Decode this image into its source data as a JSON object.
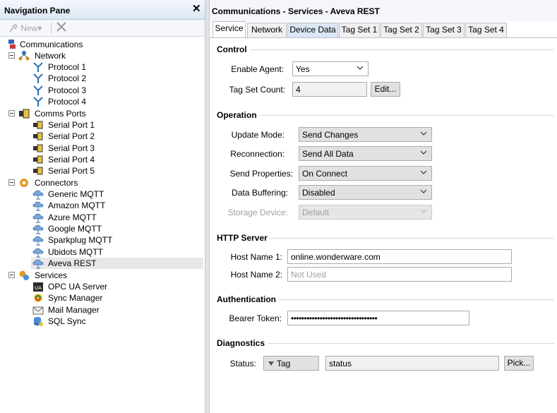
{
  "nav": {
    "title": "Navigation Pane",
    "toolbar": {
      "new_label": "New",
      "new_arrow": "▾"
    },
    "tree": {
      "root": {
        "label": "Communications",
        "icon": "communications-icon"
      },
      "network": {
        "label": "Network",
        "icon": "network-icon",
        "items": [
          "Protocol 1",
          "Protocol 2",
          "Protocol 3",
          "Protocol 4"
        ]
      },
      "comms_ports": {
        "label": "Comms Ports",
        "icon": "comms-ports-icon",
        "items": [
          "Serial Port 1",
          "Serial Port 2",
          "Serial Port 3",
          "Serial Port 4",
          "Serial Port 5"
        ]
      },
      "connectors": {
        "label": "Connectors",
        "icon": "connectors-icon",
        "items": [
          "Generic MQTT",
          "Amazon MQTT",
          "Azure MQTT",
          "Google MQTT",
          "Sparkplug MQTT",
          "Ubidots MQTT",
          "Aveva REST"
        ],
        "selected": "Aveva REST"
      },
      "services": {
        "label": "Services",
        "icon": "services-icon",
        "items": [
          "OPC UA Server",
          "Sync Manager",
          "Mail Manager",
          "SQL Sync"
        ]
      }
    }
  },
  "details": {
    "title": "Communications - Services - Aveva REST",
    "tabs": [
      "Service",
      "Network",
      "Device Data",
      "Tag Set 1",
      "Tag Set 2",
      "Tag Set 3",
      "Tag Set 4"
    ],
    "active_tab": "Service",
    "control": {
      "heading": "Control",
      "enable_agent_label": "Enable Agent:",
      "enable_agent_value": "Yes",
      "tag_set_count_label": "Tag Set Count:",
      "tag_set_count_value": "4",
      "edit_label": "Edit..."
    },
    "operation": {
      "heading": "Operation",
      "update_mode_label": "Update Mode:",
      "update_mode_value": "Send Changes",
      "reconnection_label": "Reconnection:",
      "reconnection_value": "Send All Data",
      "send_properties_label": "Send Properties:",
      "send_properties_value": "On Connect",
      "data_buffering_label": "Data Buffering:",
      "data_buffering_value": "Disabled",
      "storage_device_label": "Storage Device:",
      "storage_device_value": "Default"
    },
    "http_server": {
      "heading": "HTTP Server",
      "host1_label": "Host Name 1:",
      "host1_value": "online.wonderware.com",
      "host2_label": "Host Name 2:",
      "host2_placeholder": "Not Used"
    },
    "authentication": {
      "heading": "Authentication",
      "bearer_label": "Bearer Token:",
      "bearer_value": "•••••••••••••••••••••••••••••••••"
    },
    "diagnostics": {
      "heading": "Diagnostics",
      "status_label": "Status:",
      "tag_dropdown_label": "Tag",
      "status_value": "status",
      "pick_label": "Pick..."
    }
  },
  "colors": {
    "header_gradient_top": "#f4f8fd",
    "header_gradient_bottom": "#dce7f4",
    "selected_row": "#e8e8e8",
    "tab_hover": "#dbe7f5"
  }
}
